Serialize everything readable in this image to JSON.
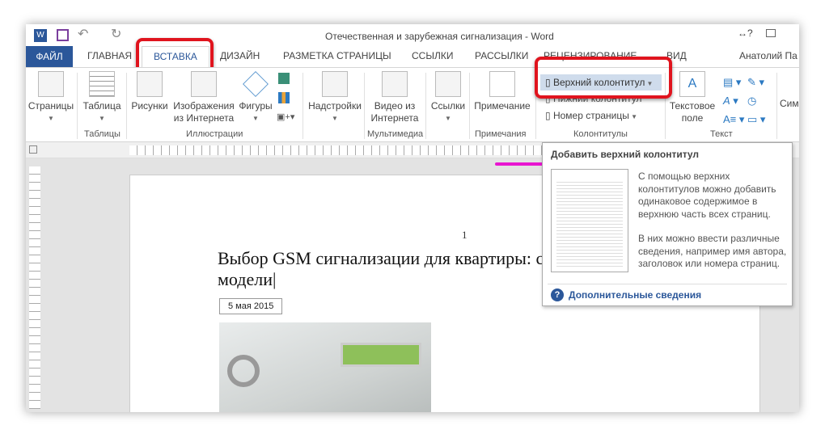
{
  "window": {
    "title": "Отечественная и зарубежная сигнализация - Word"
  },
  "tabs": {
    "file": "ФАЙЛ",
    "items": [
      "ГЛАВНАЯ",
      "ВСТАВКА",
      "ДИЗАЙН",
      "РАЗМЕТКА СТРАНИЦЫ",
      "ССЫЛКИ",
      "РАССЫЛКИ",
      "РЕЦЕНЗИРОВАНИЕ",
      "ВИД"
    ],
    "user": "Анатолий Па"
  },
  "ribbon": {
    "pages": "Страницы",
    "table": "Таблица",
    "pictures": "Рисунки",
    "online_images": "Изображения из Интернета",
    "shapes": "Фигуры",
    "addins": "Надстройки",
    "online_video": "Видео из Интернета",
    "links": "Ссылки",
    "comment": "Примечание",
    "header": "Верхний колонтитул",
    "footer": "Нижний колонтитул",
    "page_number": "Номер страницы",
    "text_box": "Текстовое поле",
    "symbols": "Сим",
    "groups": {
      "tables": "Таблицы",
      "illustrations": "Иллюстрации",
      "media": "Мультимедиа",
      "comments": "Примечания",
      "header_footer": "Колонтитулы",
      "text": "Текст"
    }
  },
  "tooltip": {
    "title": "Добавить верхний колонтитул",
    "p1": "С помощью верхних колонтитулов можно добавить одинаковое содержимое в верхнюю часть всех страниц.",
    "p2": "В них можно ввести различные сведения, например имя автора, заголовок или номера страниц.",
    "more": "Дополнительные сведения"
  },
  "document": {
    "page_number": "1",
    "heading": "Выбор GSM сигнализации для квартиры: с",
    "heading2": "модели",
    "date": "5 мая 2015"
  },
  "colors": {
    "accent": "#2b579a",
    "highlight": "#e0141e",
    "magenta": "#e815d0"
  }
}
